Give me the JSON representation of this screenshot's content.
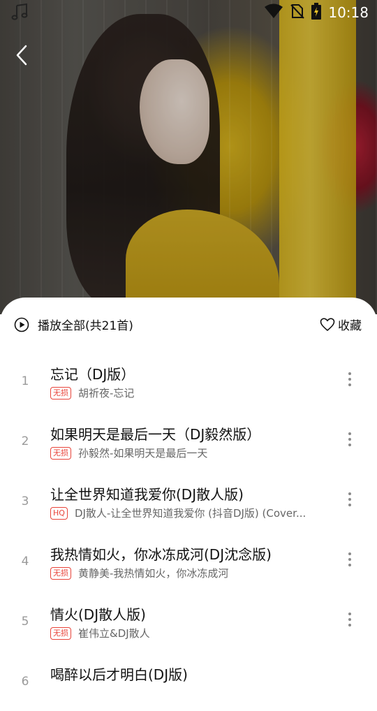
{
  "status_bar": {
    "time": "10:18",
    "icons": [
      "music-note-icon",
      "wifi-icon",
      "no-sim-icon",
      "battery-charging-icon"
    ]
  },
  "header": {
    "back_icon": "chevron-left-icon"
  },
  "toolbar": {
    "play_all_label": "播放全部(共21首)",
    "play_icon": "play-circle-icon",
    "collect_label": "收藏",
    "collect_icon": "heart-outline-icon"
  },
  "songs": [
    {
      "index": "1",
      "title": "忘记（DJ版）",
      "badge": "无损",
      "artist": "胡祈夜-忘记"
    },
    {
      "index": "2",
      "title": "如果明天是最后一天（DJ毅然版）",
      "badge": "无损",
      "artist": "孙毅然-如果明天是最后一天"
    },
    {
      "index": "3",
      "title": "让全世界知道我爱你(DJ散人版)",
      "badge": "HQ",
      "artist": "DJ散人-让全世界知道我爱你 (抖音DJ版) (Cover..."
    },
    {
      "index": "4",
      "title": "我热情如火，你冰冻成河(DJ沈念版)",
      "badge": "无损",
      "artist": "黄静美-我热情如火，你冰冻成河"
    },
    {
      "index": "5",
      "title": "情火(DJ散人版)",
      "badge": "无损",
      "artist": "崔伟立&DJ散人"
    },
    {
      "index": "6",
      "title": "喝醉以后才明白(DJ版)",
      "badge": "",
      "artist": ""
    }
  ],
  "colors": {
    "badge_red": "#e8443a",
    "text_primary": "#111111",
    "text_secondary": "#666666",
    "index_gray": "#9a9a9a"
  }
}
